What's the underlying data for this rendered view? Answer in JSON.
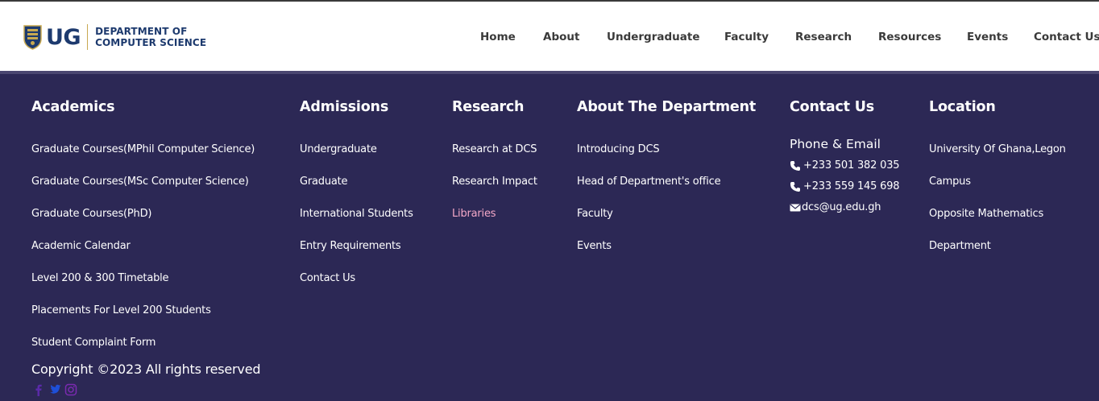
{
  "header": {
    "logo_abbrev": "UG",
    "dept_line1": "DEPARTMENT OF",
    "dept_line2": "COMPUTER SCIENCE",
    "nav": [
      "Home",
      "About",
      "Undergraduate",
      "Faculty",
      "Research",
      "Resources",
      "Events",
      "Contact Us"
    ]
  },
  "footer": {
    "academics": {
      "title": "Academics",
      "links": [
        "Graduate Courses(MPhil Computer Science)",
        "Graduate Courses(MSc Computer Science)",
        "Graduate Courses(PhD)",
        "Academic Calendar",
        "Level 200 & 300 Timetable",
        "Placements For Level 200 Students",
        "Student Complaint Form"
      ]
    },
    "admissions": {
      "title": "Admissions",
      "links": [
        "Undergraduate",
        "Graduate",
        "International Students",
        "Entry Requirements",
        "Contact Us"
      ]
    },
    "research": {
      "title": "Research",
      "links": [
        "Research at DCS",
        "Research Impact",
        "Libraries"
      ],
      "highlight_color": "#f4a8c8"
    },
    "about": {
      "title": "About The Department",
      "links": [
        "Introducing DCS",
        "Head of Department's office",
        "Faculty",
        "Events"
      ]
    },
    "contact": {
      "title": "Contact Us",
      "subtitle": "Phone & Email",
      "phone1": "+233 501 382 035",
      "phone2": "+233 559 145 698",
      "email": "dcs@ug.edu.gh",
      "icons": [
        "phone-icon",
        "phone-icon",
        "envelope-icon"
      ]
    },
    "location": {
      "title": "Location",
      "lines": [
        "University Of Ghana,Legon",
        "Campus",
        "Opposite Mathematics",
        "Department"
      ]
    },
    "copyright": "Copyright ©2023 All rights reserved",
    "social_icons": [
      "facebook-icon",
      "twitter-icon",
      "instagram-icon"
    ]
  },
  "colors": {
    "footer_bg": "#2c2855",
    "brand_blue": "#1d3a6e",
    "link_highlight": "#f4a8c8",
    "header_bg": "#ffffff"
  }
}
